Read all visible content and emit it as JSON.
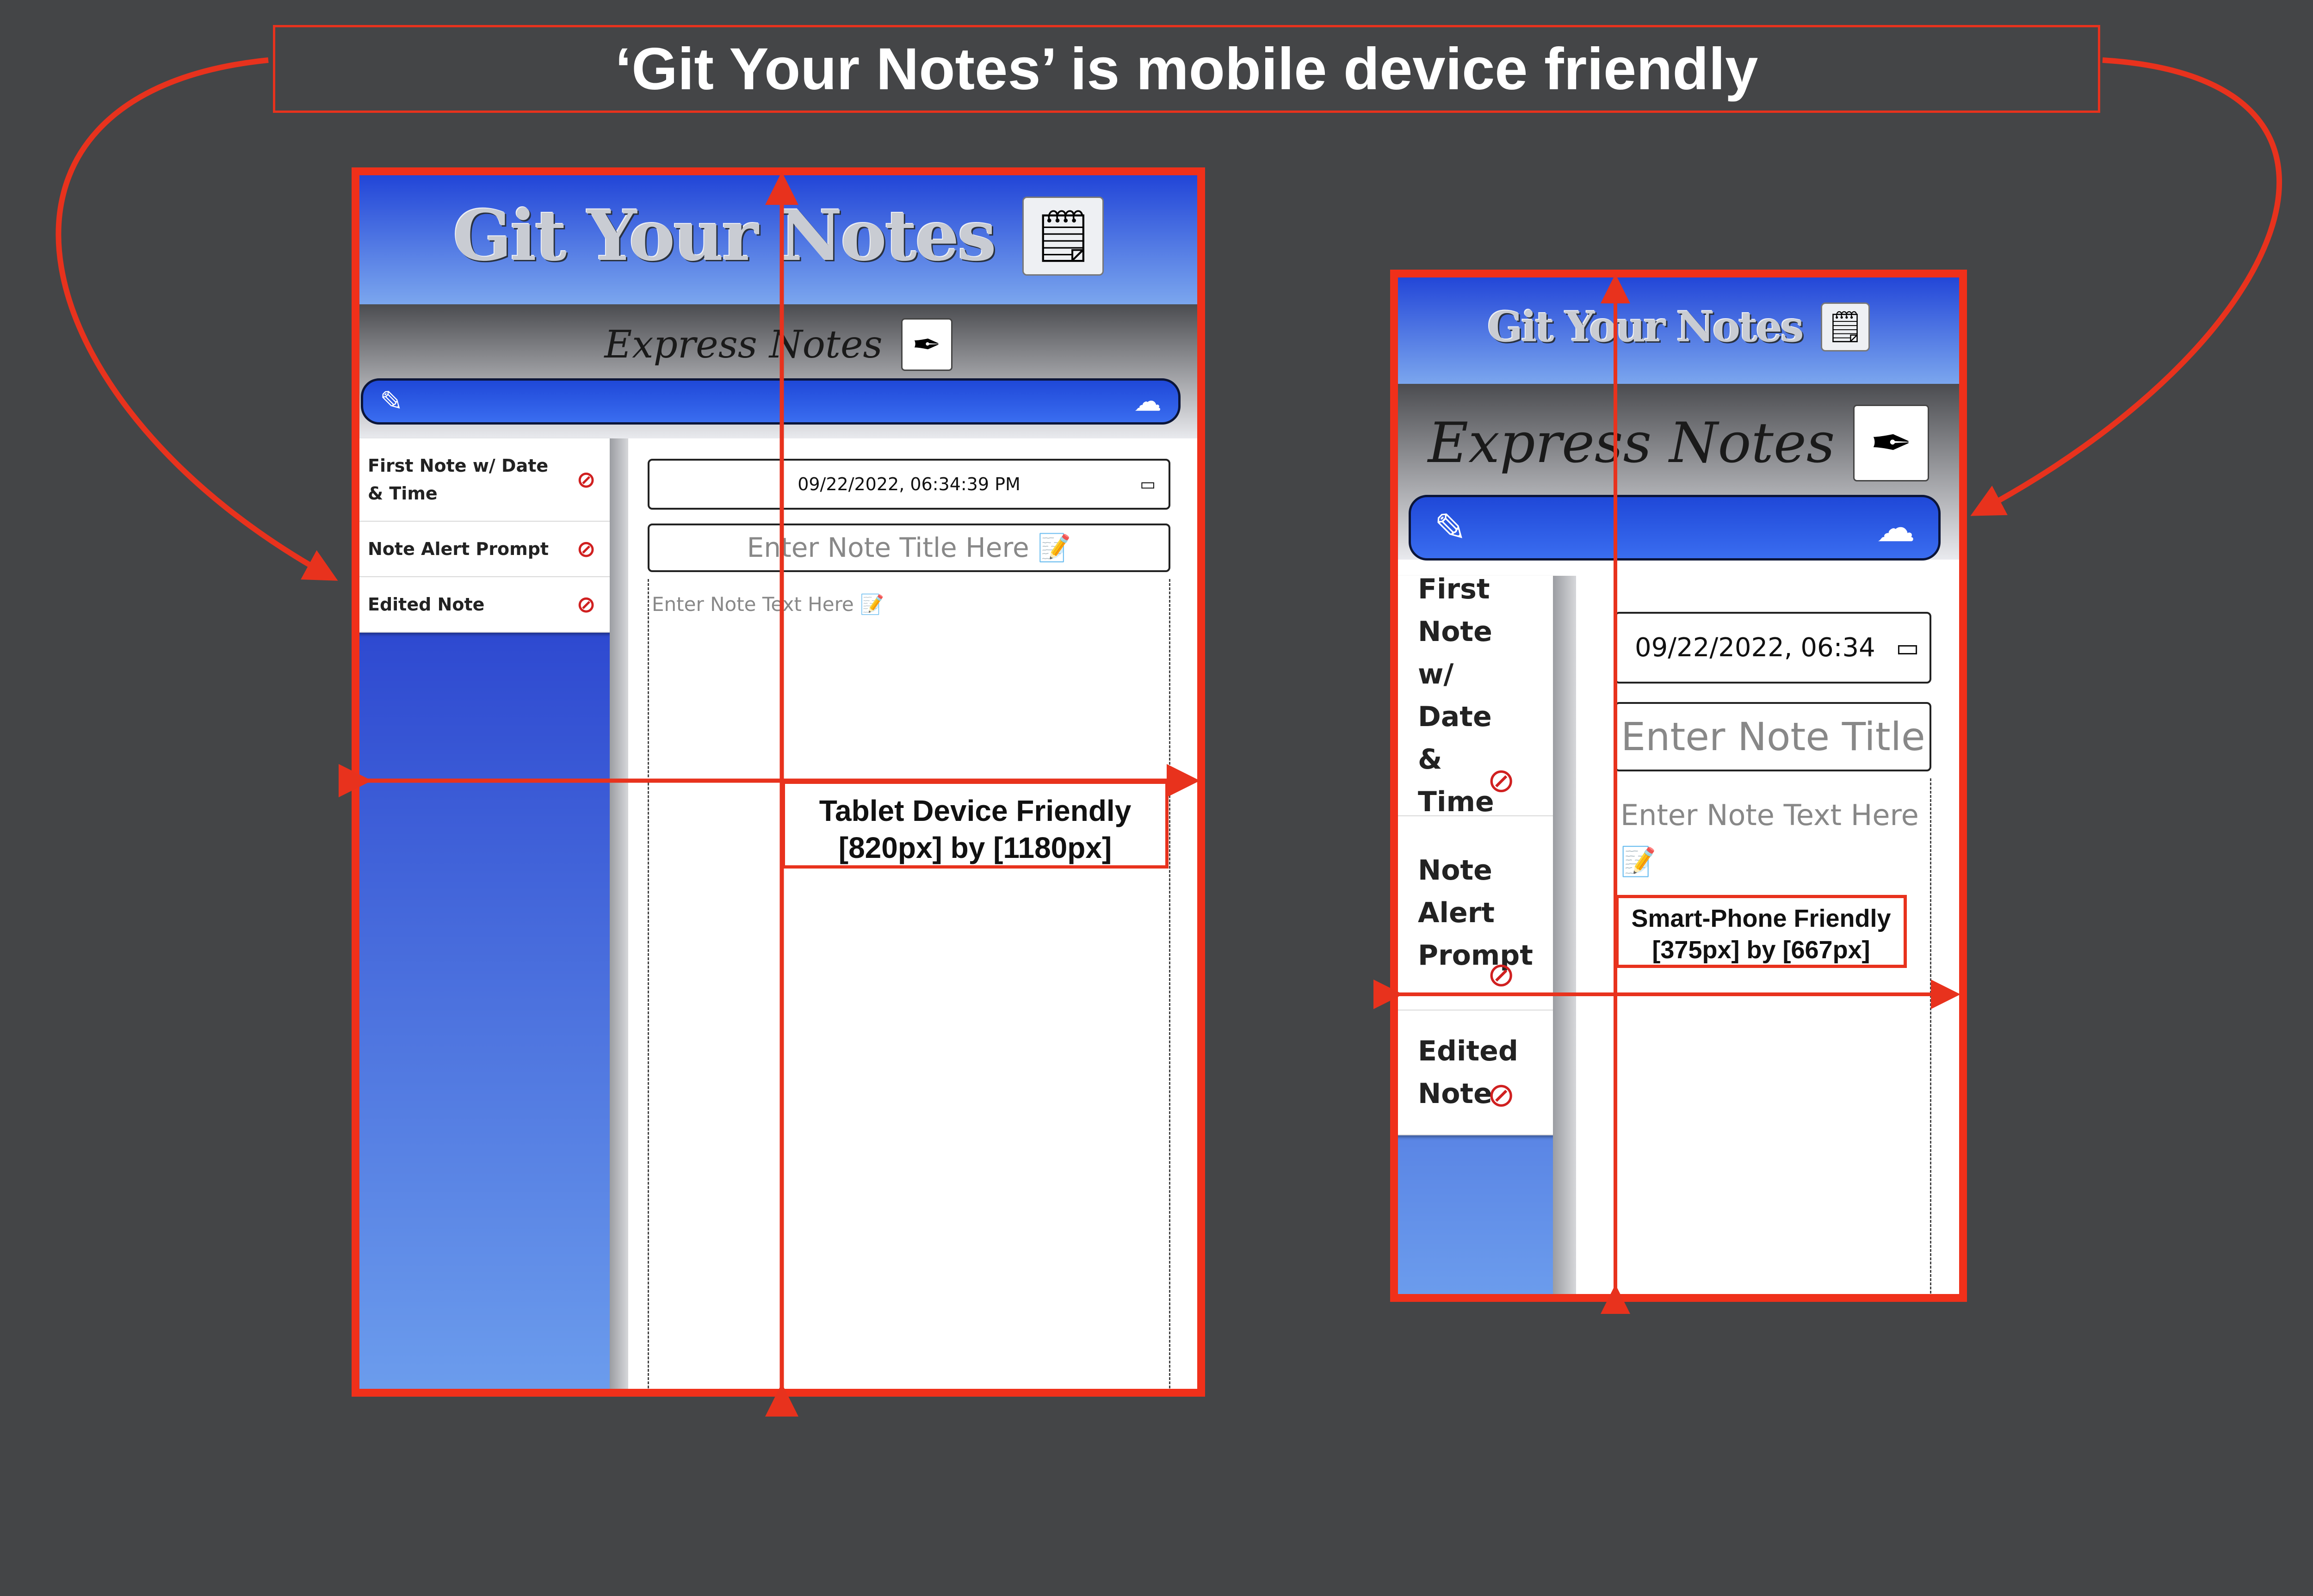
{
  "banner": {
    "title": "‘Git Your Notes’ is mobile device friendly"
  },
  "colors": {
    "accent_red": "#e8321d",
    "header_blue": "#1c3fd6",
    "background": "#444547"
  },
  "app": {
    "logo_text": "Git Your Notes",
    "subtitle": "Express Notes",
    "notes": [
      "First Note w/ Date & Time",
      "Note Alert Prompt",
      "Edited Note"
    ],
    "note_delete_icon": "no-entry-icon",
    "edit_icon": "edit-icon",
    "save_icon": "cloud-download-icon"
  },
  "tablet": {
    "date_value": "09/22/2022, 06:34:39 PM",
    "title_placeholder": "Enter Note Title Here 📝",
    "text_placeholder": "Enter Note Text Here 📝",
    "label_line1": "Tablet Device Friendly",
    "label_line2": "[820px] by [1180px]"
  },
  "phone": {
    "date_value": "09/22/2022, 06:34",
    "title_placeholder": "Enter Note Title Here",
    "text_placeholder": "Enter Note Text Here",
    "text_emoji": "📝",
    "label_line1": "Smart-Phone Friendly",
    "label_line2": "[375px] by [667px]"
  }
}
